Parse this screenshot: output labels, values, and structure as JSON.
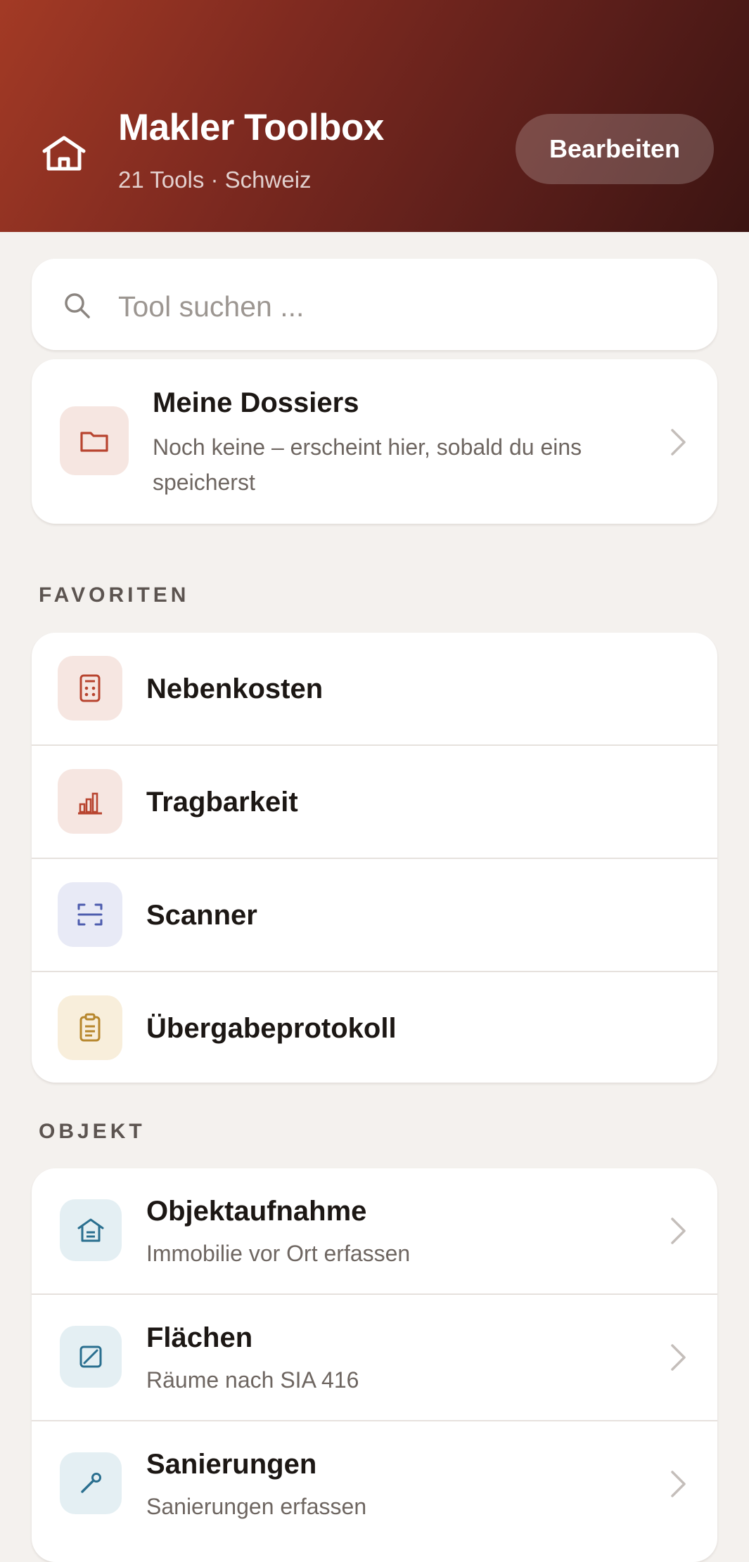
{
  "header": {
    "title": "Makler Toolbox",
    "subtitle": "21 Tools · Schweiz",
    "edit_label": "Bearbeiten",
    "icon": "home-icon"
  },
  "search": {
    "placeholder": "Tool suchen ...",
    "value": "",
    "icon": "search-icon"
  },
  "dossiers": {
    "title": "Meine Dossiers",
    "subtitle_line1": "Noch keine – erscheint hier, sobald du eins",
    "subtitle_line2": "speicherst",
    "icon": "folder-icon"
  },
  "favorites": {
    "label": "FAVORITEN",
    "items": [
      {
        "label": "Nebenkosten",
        "icon": "calculator-icon",
        "color": "#b8442f"
      },
      {
        "label": "Tragbarkeit",
        "icon": "bar-chart-icon",
        "color": "#b8442f"
      },
      {
        "label": "Scanner",
        "icon": "scan-icon",
        "color": "#4d5cae"
      },
      {
        "label": "Übergabeprotokoll",
        "icon": "clipboard-icon",
        "color": "#b7872d"
      }
    ]
  },
  "object": {
    "label": "OBJEKT",
    "items": [
      {
        "label": "Objektaufnahme",
        "sublabel": "Immobilie vor Ort erfassen",
        "icon": "house-icon"
      },
      {
        "label": "Flächen",
        "sublabel": "Räume nach SIA 416",
        "icon": "area-icon"
      },
      {
        "label": "Sanierungen",
        "sublabel": "Sanierungen erfassen",
        "icon": "wrench-icon"
      }
    ],
    "color": "#2a6f8f"
  }
}
